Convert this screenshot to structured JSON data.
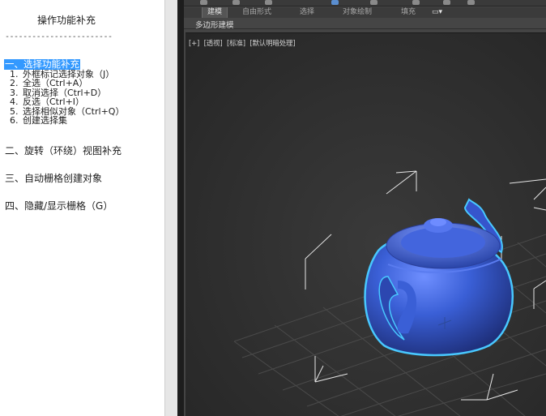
{
  "notes": {
    "title": "操作功能补充",
    "dash_line": "------------------------",
    "section1_head": "一、选择功能补充",
    "items": [
      {
        "num": "1.",
        "text": "外框标记选择对象（J）"
      },
      {
        "num": "2.",
        "text": "全选（Ctrl+A）"
      },
      {
        "num": "3.",
        "text": "取消选择（Ctrl+D）"
      },
      {
        "num": "4.",
        "text": "反选（Ctrl+I）"
      },
      {
        "num": "5.",
        "text": "选择相似对象（Ctrl+Q）"
      },
      {
        "num": "6.",
        "text": "创建选择集"
      }
    ],
    "section2": "二、旋转（环绕）视图补充",
    "section3": "三、自动栅格创建对象",
    "section4": "四、隐藏/显示栅格（G）"
  },
  "ribbon": {
    "tabs": [
      "建模",
      "自由形式",
      "选择",
      "对象绘制",
      "填充"
    ],
    "sub_label": "多边形建模"
  },
  "viewport": {
    "labels": [
      "[+]",
      "[透视]",
      "[标准]",
      "[默认明暗处理]"
    ]
  },
  "colors": {
    "teapot": "#3a5fd6",
    "selection_outline": "#48c8ff",
    "highlight": "#3399ff"
  }
}
